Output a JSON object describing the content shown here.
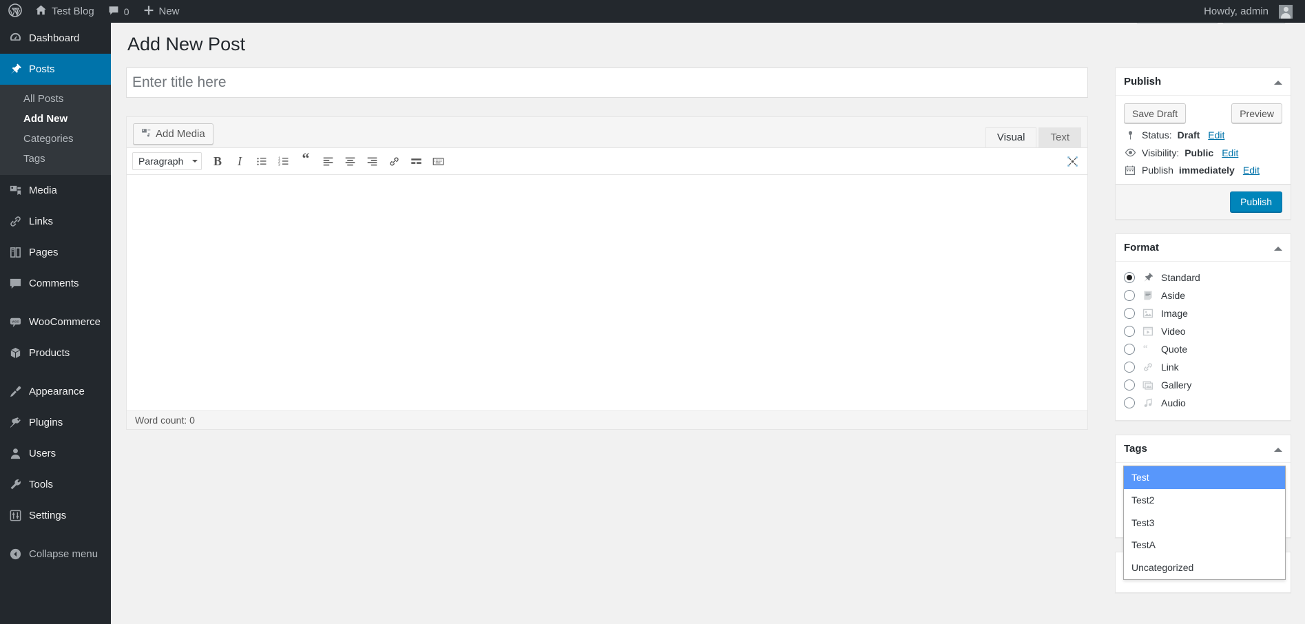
{
  "adminbar": {
    "logo_icon": "wordpress-logo-icon",
    "site_name": "Test Blog",
    "home_icon": "home-icon",
    "comments_icon": "comment-bubble-icon",
    "comments_count": "0",
    "new_icon": "plus-icon",
    "new_label": "New",
    "howdy": "Howdy, admin",
    "avatar": "avatar"
  },
  "sidebar": {
    "items": [
      {
        "label": "Dashboard",
        "icon": "dashboard-icon",
        "current": false
      },
      {
        "label": "Posts",
        "icon": "pin-icon",
        "current": true
      },
      {
        "label": "Media",
        "icon": "media-icon",
        "current": false
      },
      {
        "label": "Links",
        "icon": "link-icon",
        "current": false
      },
      {
        "label": "Pages",
        "icon": "pages-icon",
        "current": false
      },
      {
        "label": "Comments",
        "icon": "comment-bubble-icon",
        "current": false
      },
      {
        "label": "WooCommerce",
        "icon": "woocommerce-icon",
        "current": false
      },
      {
        "label": "Products",
        "icon": "products-box-icon",
        "current": false
      },
      {
        "label": "Appearance",
        "icon": "appearance-brush-icon",
        "current": false
      },
      {
        "label": "Plugins",
        "icon": "plugins-plug-icon",
        "current": false
      },
      {
        "label": "Users",
        "icon": "users-icon",
        "current": false
      },
      {
        "label": "Tools",
        "icon": "tools-wrench-icon",
        "current": false
      },
      {
        "label": "Settings",
        "icon": "settings-sliders-icon",
        "current": false
      }
    ],
    "submenu": [
      {
        "label": "All Posts",
        "current": false
      },
      {
        "label": "Add New",
        "current": true
      },
      {
        "label": "Categories",
        "current": false
      },
      {
        "label": "Tags",
        "current": false
      }
    ],
    "collapse": {
      "label": "Collapse menu",
      "icon": "collapse-arrow-icon"
    }
  },
  "page": {
    "title": "Add New Post"
  },
  "title_field": {
    "value": "",
    "placeholder": "Enter title here"
  },
  "editor": {
    "add_media_label": "Add Media",
    "add_media_icon": "add-media-icon",
    "tabs": [
      {
        "label": "Visual",
        "active": true
      },
      {
        "label": "Text",
        "active": false
      }
    ],
    "format_select": "Paragraph",
    "toolbar": [
      {
        "name": "bold-button",
        "glyph": "B"
      },
      {
        "name": "italic-button",
        "glyph": "I"
      },
      {
        "name": "bulleted-list-button",
        "glyph": ""
      },
      {
        "name": "numbered-list-button",
        "glyph": ""
      },
      {
        "name": "blockquote-button",
        "glyph": "“"
      },
      {
        "name": "align-left-button",
        "glyph": ""
      },
      {
        "name": "align-center-button",
        "glyph": ""
      },
      {
        "name": "align-right-button",
        "glyph": ""
      },
      {
        "name": "insert-link-button",
        "glyph": ""
      },
      {
        "name": "read-more-button",
        "glyph": ""
      },
      {
        "name": "toolbar-toggle-button",
        "glyph": ""
      }
    ],
    "fullscreen_icon": "distraction-free-icon",
    "body_value": "",
    "status_info": "Word count: 0"
  },
  "publish_box": {
    "title": "Publish",
    "save_draft_label": "Save Draft",
    "preview_label": "Preview",
    "status_icon": "pin-status-icon",
    "status_label": "Status:",
    "status_value": "Draft",
    "status_edit": "Edit",
    "visibility_icon": "eye-icon",
    "visibility_label": "Visibility:",
    "visibility_value": "Public",
    "visibility_edit": "Edit",
    "schedule_icon": "calendar-icon",
    "schedule_label": "Publish",
    "schedule_value": "immediately",
    "schedule_edit": "Edit",
    "publish_label": "Publish",
    "primary_color": "#0085ba"
  },
  "format_box": {
    "title": "Format",
    "options": [
      {
        "label": "Standard",
        "icon": "pin-icon",
        "selected": true
      },
      {
        "label": "Aside",
        "icon": "aside-note-icon",
        "selected": false
      },
      {
        "label": "Image",
        "icon": "image-icon",
        "selected": false
      },
      {
        "label": "Video",
        "icon": "video-icon",
        "selected": false
      },
      {
        "label": "Quote",
        "icon": "quote-icon",
        "selected": false
      },
      {
        "label": "Link",
        "icon": "link-icon",
        "selected": false
      },
      {
        "label": "Gallery",
        "icon": "gallery-icon",
        "selected": false
      },
      {
        "label": "Audio",
        "icon": "audio-note-icon",
        "selected": false
      }
    ]
  },
  "tags_box": {
    "title": "Tags",
    "input_value": "",
    "suggestions": [
      {
        "label": "Test",
        "selected": true
      },
      {
        "label": "Test2",
        "selected": false
      },
      {
        "label": "Test3",
        "selected": false
      },
      {
        "label": "TestA",
        "selected": false
      },
      {
        "label": "Uncategorized",
        "selected": false
      }
    ],
    "highlight_color": "#5897fb"
  }
}
